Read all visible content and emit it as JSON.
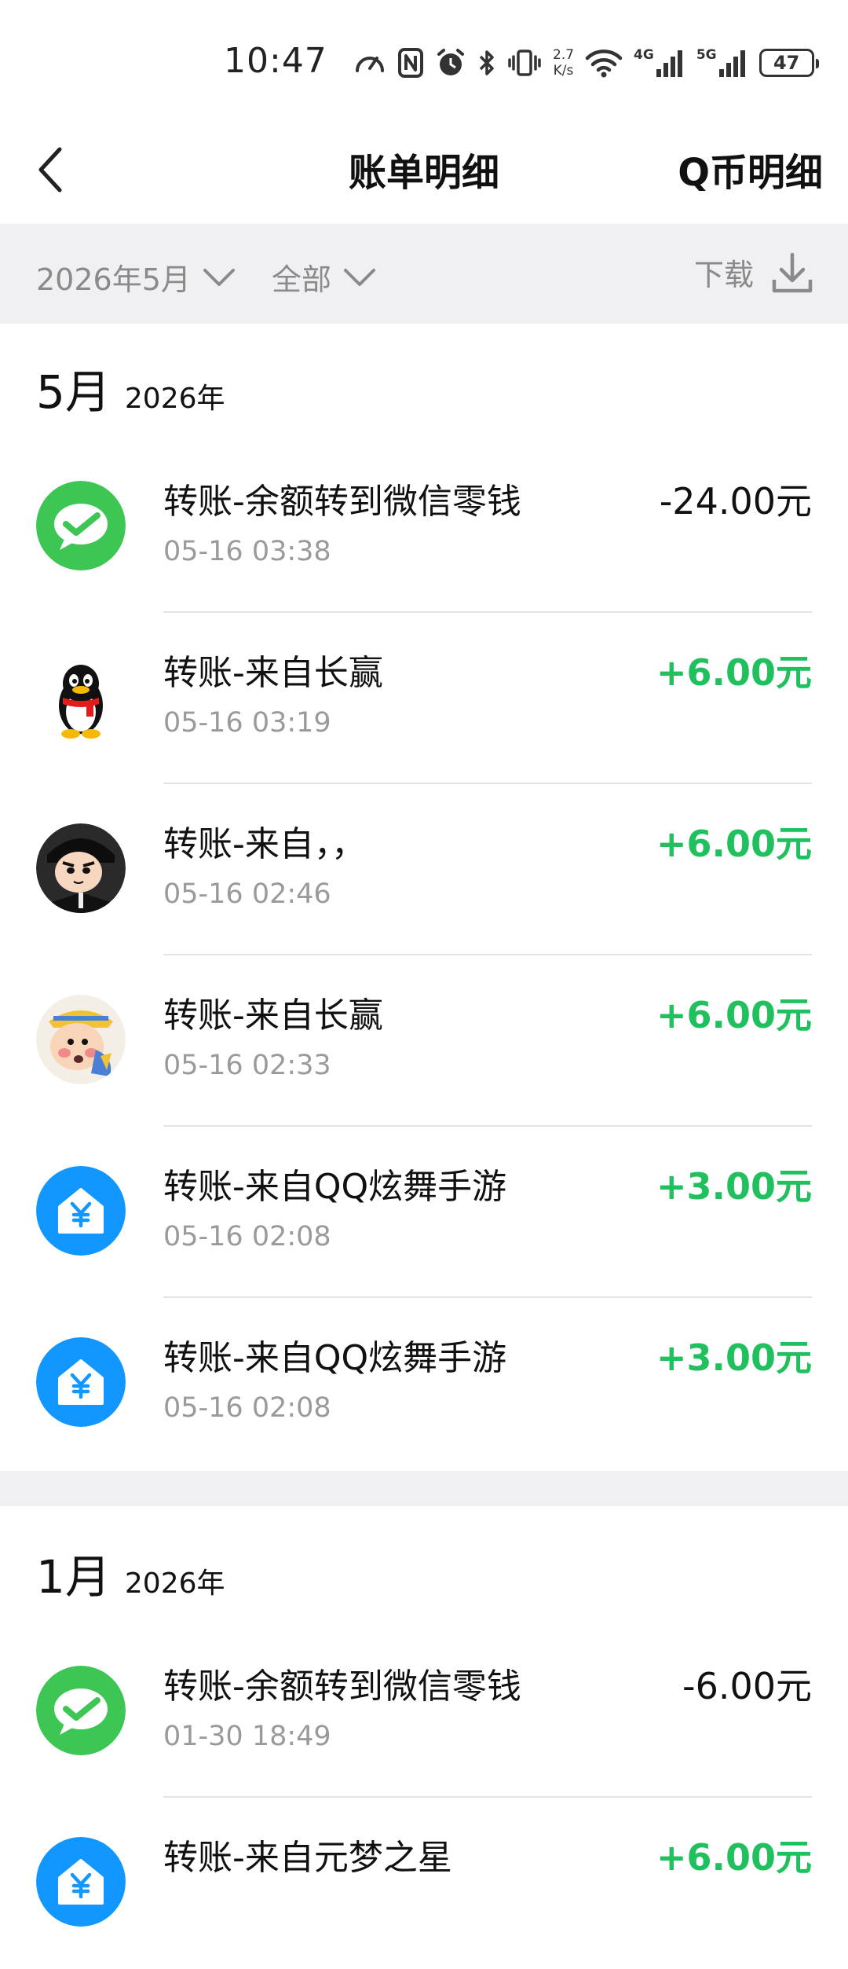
{
  "status_bar": {
    "time": "10:47",
    "net_speed_value": "2.7",
    "net_speed_unit": "K/s",
    "signal_1_label": "4G",
    "signal_2_label": "5G",
    "battery": "47",
    "icons": [
      "speedometer-icon",
      "nfc-icon",
      "alarm-icon",
      "bluetooth-icon",
      "vibrate-icon",
      "wifi-icon",
      "signal-icon",
      "signal-icon",
      "battery-icon"
    ]
  },
  "header": {
    "back_icon": "chevron-left-icon",
    "title": "账单明细",
    "right_action": "Q币明细"
  },
  "filter": {
    "month": "2026年5月",
    "type": "全部",
    "download": "下载",
    "download_icon": "download-icon"
  },
  "colors": {
    "positive": "#21c05f",
    "negative": "#111111",
    "wechat_green": "#3dc653",
    "qq_blue": "#1296ff",
    "filter_bg": "#f0f0f2"
  },
  "sections": [
    {
      "month": "5月",
      "year": "2026年",
      "items": [
        {
          "title": "转账-余额转到微信零钱",
          "time": "05-16 03:38",
          "amount": "-24.00元",
          "avatar": "wechat-icon"
        },
        {
          "title": "转账-来自长赢",
          "time": "05-16 03:19",
          "amount": "+6.00元",
          "avatar": "qq-penguin-icon"
        },
        {
          "title": "转账-来自，，",
          "time": "05-16 02:46",
          "amount": "+6.00元",
          "avatar": "cartoon-avatar"
        },
        {
          "title": "转账-来自长赢",
          "time": "05-16 02:33",
          "amount": "+6.00元",
          "avatar": "cartoon-avatar"
        },
        {
          "title": "转账-来自QQ炫舞手游",
          "time": "05-16 02:08",
          "amount": "+3.00元",
          "avatar": "yuan-house-icon"
        },
        {
          "title": "转账-来自QQ炫舞手游",
          "time": "05-16 02:08",
          "amount": "+3.00元",
          "avatar": "yuan-house-icon"
        }
      ]
    },
    {
      "month": "1月",
      "year": "2026年",
      "items": [
        {
          "title": "转账-余额转到微信零钱",
          "time": "01-30 18:49",
          "amount": "-6.00元",
          "avatar": "wechat-icon"
        },
        {
          "title": "转账-来自元梦之星",
          "time": "",
          "amount": "+6.00元",
          "avatar": "yuan-house-icon"
        }
      ]
    }
  ]
}
